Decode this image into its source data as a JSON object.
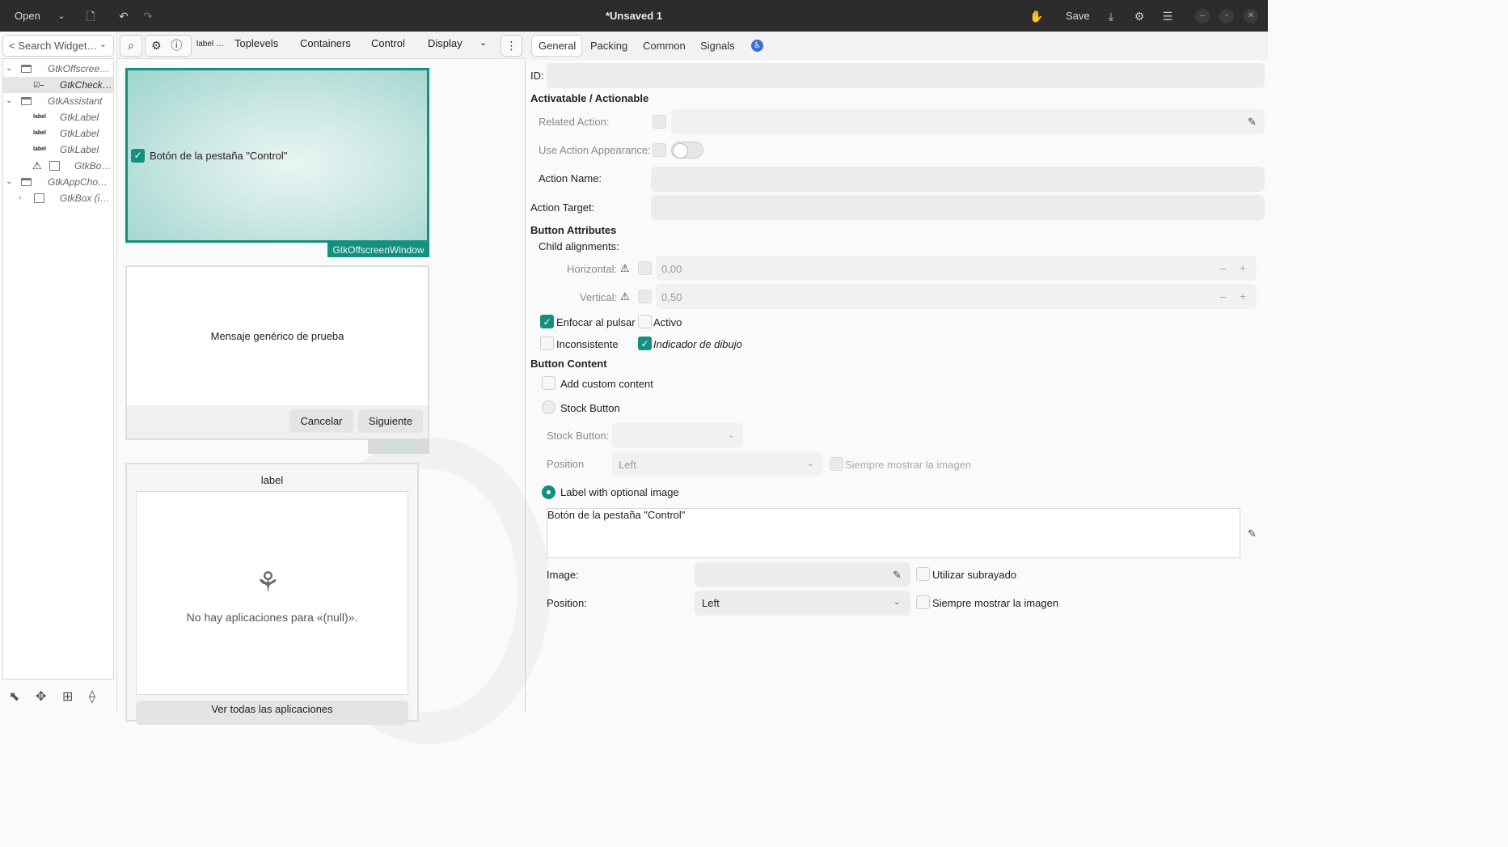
{
  "header": {
    "open_label": "Open",
    "title": "*Unsaved 1",
    "save_label": "Save"
  },
  "left": {
    "search_placeholder": "< Search Widget…",
    "tree": [
      {
        "label": "GtkOffscree…",
        "icon": "window-icon"
      },
      {
        "label": "GtkCheck…",
        "icon": "checkbutton-icon"
      },
      {
        "label": "GtkAssistant",
        "icon": "assistant-icon"
      },
      {
        "label": "GtkLabel",
        "icon": "label-icon",
        "icon_text": "label"
      },
      {
        "label": "GtkLabel",
        "icon": "label-icon",
        "icon_text": "label"
      },
      {
        "label": "GtkLabel",
        "icon": "label-icon",
        "icon_text": "label"
      },
      {
        "label": "GtkBo…",
        "icon": "box-icon"
      },
      {
        "label": "GtkAppCho…",
        "icon": "appchooser-icon"
      },
      {
        "label": "GtkBox (i…",
        "icon": "box-icon"
      }
    ]
  },
  "palette": {
    "label_item": "label …",
    "groups": [
      "Toplevels",
      "Containers",
      "Control",
      "Display"
    ]
  },
  "canvas": {
    "checkbox_label": "Botón de la pestaña \"Control\"",
    "offscreen_tag": "GtkOffscreenWindow",
    "assistant_message": "Mensaje genérico de prueba",
    "cancel_label": "Cancelar",
    "next_label": "Siguiente",
    "assistant_tag": "GtkAssistant",
    "appchooser_title": "label",
    "no_apps": "No hay aplicaciones para «(null)».",
    "see_all": "Ver todas las aplicaciones"
  },
  "props": {
    "tabs": [
      "General",
      "Packing",
      "Common",
      "Signals"
    ],
    "id_label": "ID:",
    "section_actionable": "Activatable / Actionable",
    "related_action": "Related Action:",
    "use_action_appearance": "Use Action Appearance:",
    "action_name": "Action Name:",
    "action_target": "Action Target:",
    "section_button_attrs": "Button Attributes",
    "child_alignments": "Child alignments:",
    "horizontal": "Horizontal:",
    "horizontal_value": "0,00",
    "vertical": "Vertical:",
    "vertical_value": "0,50",
    "focus_on_click": "Enfocar al pulsar",
    "active": "Activo",
    "inconsistent": "Inconsistente",
    "draw_indicator": "Indicador de dibujo",
    "section_button_content": "Button Content",
    "add_custom": "Add custom content",
    "stock_button_radio": "Stock Button",
    "stock_button_label": "Stock Button:",
    "position_label": "Position",
    "position_value_dim": "Left",
    "always_show_image_dim": "Siempre mostrar la imagen",
    "label_with_image": "Label with optional image",
    "label_text": "Botón de la pestaña \"Control\"",
    "image_label": "Image:",
    "use_underline": "Utilizar subrayado",
    "position_label2": "Position:",
    "position_value": "Left",
    "always_show_image": "Siempre mostrar la imagen"
  },
  "colors": {
    "accent": "#14907f",
    "headerbar": "#2c2c2c"
  }
}
